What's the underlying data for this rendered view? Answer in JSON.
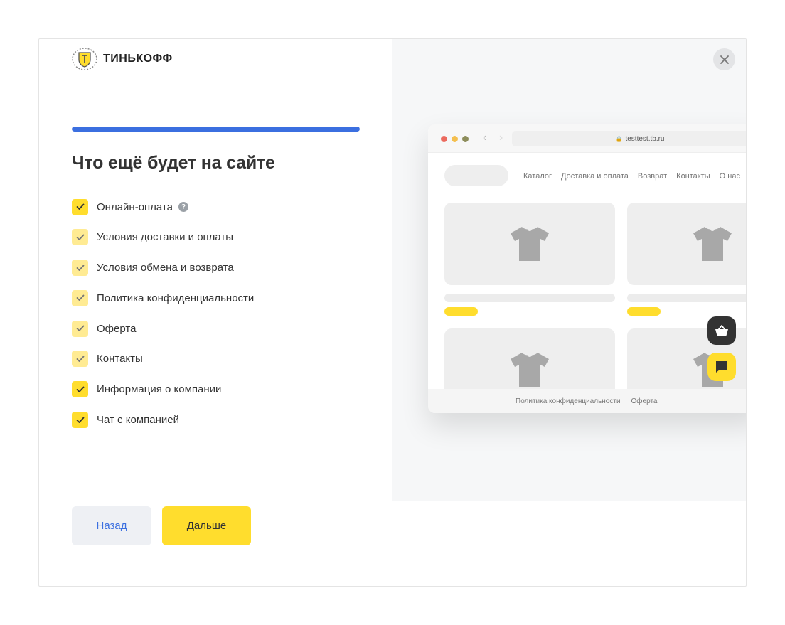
{
  "brand": {
    "name": "ТИНЬКОФФ",
    "accent": "#ffdd2d",
    "progress_color": "#3b6fe0"
  },
  "progress": {
    "fraction": 1.0
  },
  "title": "Что ещё будет на сайте",
  "options": [
    {
      "label": "Онлайн-оплата",
      "checked": true,
      "has_help": true,
      "state": "active"
    },
    {
      "label": "Условия доставки и оплаты",
      "checked": true,
      "state": "disabled"
    },
    {
      "label": "Условия обмена и возврата",
      "checked": true,
      "state": "disabled"
    },
    {
      "label": "Политика конфиденциальности",
      "checked": true,
      "state": "disabled"
    },
    {
      "label": "Оферта",
      "checked": true,
      "state": "disabled"
    },
    {
      "label": "Контакты",
      "checked": true,
      "state": "disabled"
    },
    {
      "label": "Информация о компании",
      "checked": true,
      "state": "active"
    },
    {
      "label": "Чат с компанией",
      "checked": true,
      "state": "active"
    }
  ],
  "help_icon": "?",
  "buttons": {
    "back": "Назад",
    "next": "Дальше"
  },
  "close_icon": "×",
  "preview": {
    "url": "testtest.tb.ru",
    "menu": [
      "Каталог",
      "Доставка и оплата",
      "Возврат",
      "Контакты",
      "О нас"
    ],
    "footer": [
      "Политика конфиденциальности",
      "Оферта"
    ],
    "window_dots": [
      "#ec6a5e",
      "#f4bf4f",
      "#8d8d5b"
    ]
  }
}
